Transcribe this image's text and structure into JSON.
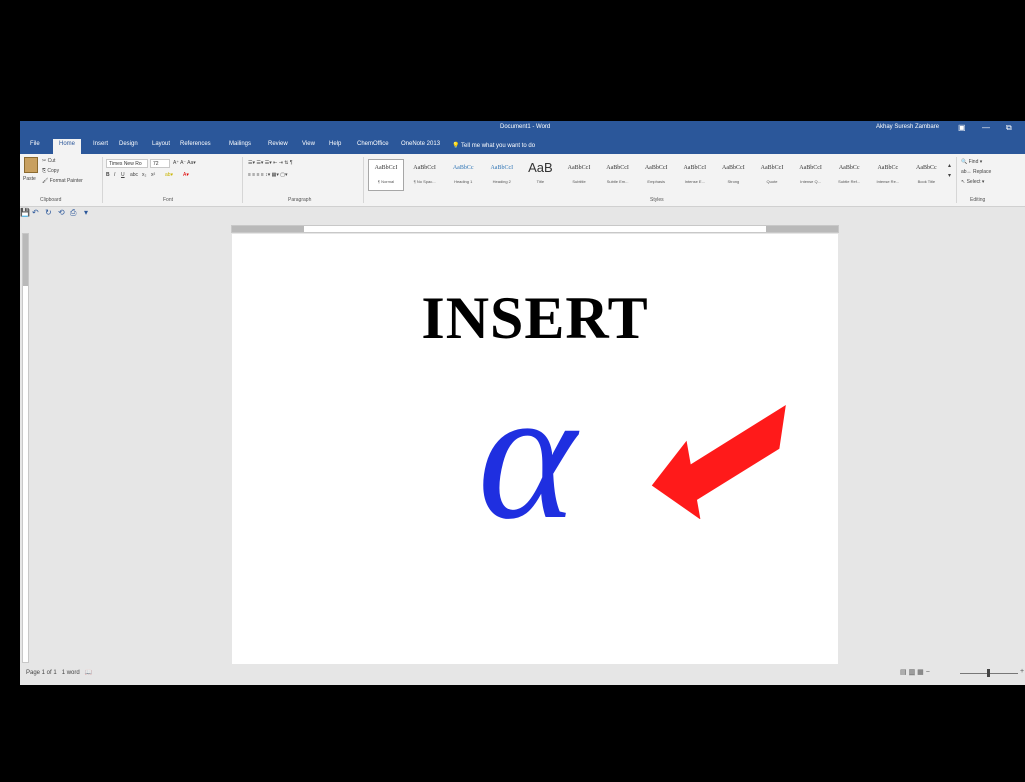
{
  "titlebar": {
    "document_title": "Document1 - Word",
    "user_name": "Akhay Suresh Zambare",
    "display_options_icon": "ribbon-display-icon",
    "minimize_icon": "minimize-icon",
    "restore_icon": "restore-icon"
  },
  "tabs": [
    {
      "label": "File"
    },
    {
      "label": "Home"
    },
    {
      "label": "Insert"
    },
    {
      "label": "Design"
    },
    {
      "label": "Layout"
    },
    {
      "label": "References"
    },
    {
      "label": "Mailings"
    },
    {
      "label": "Review"
    },
    {
      "label": "View"
    },
    {
      "label": "Help"
    },
    {
      "label": "ChemOffice"
    },
    {
      "label": "OneNote 2013"
    }
  ],
  "active_tab": "Home",
  "tell_me": "Tell me what you want to do",
  "ribbon": {
    "clipboard": {
      "paste": "Paste",
      "cut": "Cut",
      "copy": "Copy",
      "format_painter": "Format Painter",
      "group_label": "Clipboard"
    },
    "font": {
      "font_name": "Times New Ro",
      "font_size": "72",
      "group_label": "Font"
    },
    "paragraph": {
      "group_label": "Paragraph"
    },
    "styles": {
      "group_label": "Styles",
      "items": [
        {
          "preview": "AaBbCcI",
          "name": "¶ Normal"
        },
        {
          "preview": "AaBbCcI",
          "name": "¶ No Spac..."
        },
        {
          "preview": "AaBbCc",
          "name": "Heading 1"
        },
        {
          "preview": "AaBbCcI",
          "name": "Heading 2"
        },
        {
          "preview": "AaB",
          "name": "Title"
        },
        {
          "preview": "AaBbCcI",
          "name": "Subtitle"
        },
        {
          "preview": "AaBbCcI",
          "name": "Subtle Em..."
        },
        {
          "preview": "AaBbCcI",
          "name": "Emphasis"
        },
        {
          "preview": "AaBbCcI",
          "name": "Intense E..."
        },
        {
          "preview": "AaBbCcI",
          "name": "Strong"
        },
        {
          "preview": "AaBbCcI",
          "name": "Quote"
        },
        {
          "preview": "AaBbCcI",
          "name": "Intense Q..."
        },
        {
          "preview": "AaBbCc",
          "name": "Subtle Ref..."
        },
        {
          "preview": "AaBbCc",
          "name": "Intense Re..."
        },
        {
          "preview": "AaBbCc",
          "name": "Book Title"
        }
      ]
    },
    "editing": {
      "find": "Find",
      "replace": "Replace",
      "select": "Select",
      "group_label": "Editing"
    }
  },
  "document": {
    "heading": "INSERT",
    "symbol": "α",
    "symbol_color": "#1f2fe0",
    "arrow_color": "#ff1a1a"
  },
  "statusbar": {
    "page_info": "Page 1 of 1",
    "word_count": "1 word"
  },
  "colors": {
    "brand": "#2b579a",
    "ribbon_bg": "#f3f3f3",
    "workspace_bg": "#e6e6e6"
  }
}
